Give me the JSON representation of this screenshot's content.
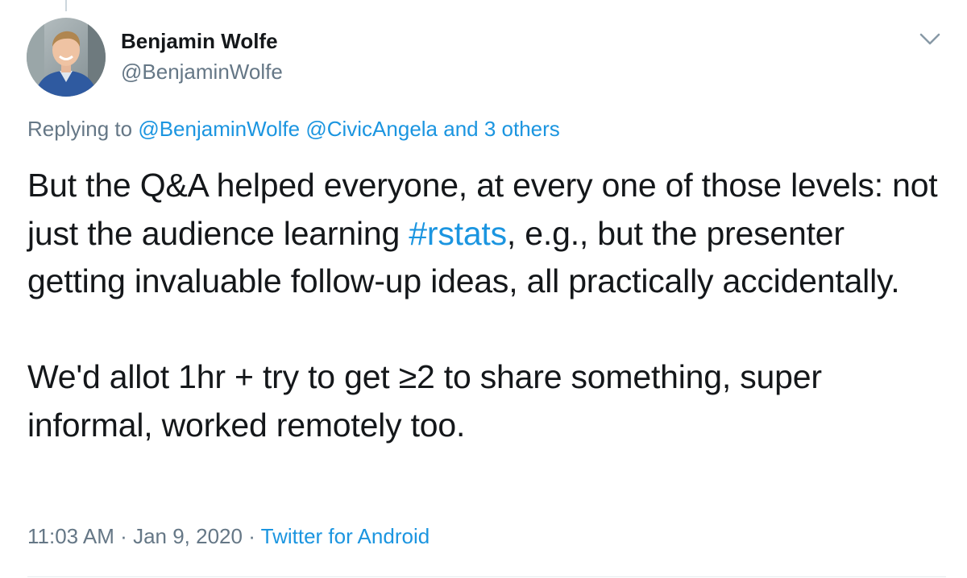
{
  "author": {
    "name": "Benjamin Wolfe",
    "handle": "@BenjaminWolfe"
  },
  "reply": {
    "prefix": "Replying to",
    "mention1": "@BenjaminWolfe",
    "mention2": "@CivicAngela",
    "others": "and 3 others"
  },
  "tweet": {
    "p1_before": "But the Q&A helped everyone, at every one of those levels: not just the audience learning ",
    "hashtag": "#rstats",
    "p1_after": ", e.g., but the presenter getting invaluable follow-up ideas, all practically accidentally.",
    "p2": "We'd allot 1hr + try to get ≥2 to share something, super informal, worked remotely too."
  },
  "meta": {
    "time": "11:03 AM",
    "separator": "·",
    "date": "Jan 9, 2020",
    "source": "Twitter for Android"
  },
  "icons": {
    "menu": "chevron-down-icon"
  },
  "colors": {
    "link": "#1b95e0",
    "secondary_text": "#657786",
    "primary_text": "#14171a"
  }
}
